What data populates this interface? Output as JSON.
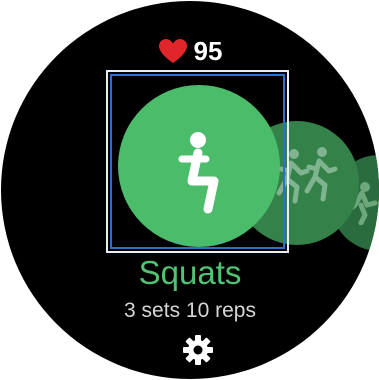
{
  "heart_rate": {
    "value": "95",
    "icon": "heart-icon",
    "color": "#e0262b"
  },
  "workout": {
    "name": "Squats",
    "detail": "3 sets 10 reps",
    "accent": "#52c274"
  },
  "carousel": {
    "items": [
      {
        "icon": "squat-icon",
        "state": "selected"
      },
      {
        "icon": "running-figures-icon",
        "state": "next"
      },
      {
        "icon": "running-icon",
        "state": "next"
      }
    ]
  },
  "settings": {
    "icon": "gear-icon"
  }
}
